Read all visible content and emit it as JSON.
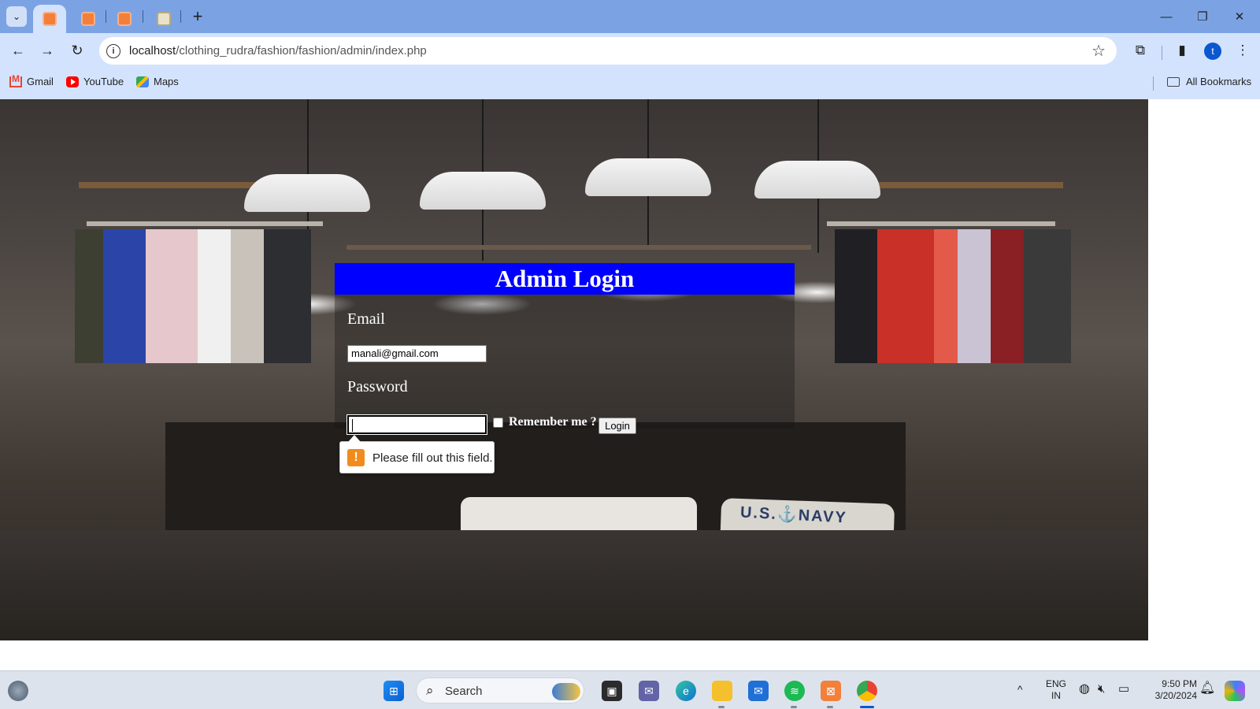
{
  "browser": {
    "address": {
      "host": "localhost",
      "path": "/clothing_rudra/fashion/fashion/admin/index.php"
    },
    "new_tab_symbol": "+",
    "profile_initial": "t",
    "bookmarks": [
      {
        "label": "Gmail",
        "icon": "gmail-icon"
      },
      {
        "label": "YouTube",
        "icon": "youtube-icon"
      },
      {
        "label": "Maps",
        "icon": "maps-icon"
      }
    ],
    "all_bookmarks_label": "All Bookmarks"
  },
  "login": {
    "heading": "Admin Login",
    "email_label": "Email",
    "email_value": "manali@gmail.com",
    "password_label": "Password",
    "password_value": "",
    "remember_label": "Remember me ?",
    "remember_checked": false,
    "submit_label": "Login",
    "heading_color": "#0000ff"
  },
  "validation": {
    "message": "Please fill out this field.",
    "icon_symbol": "!",
    "icon_color": "#f18b1c"
  },
  "background_scene": {
    "navy_text": "U.S.⚓NAVY"
  },
  "taskbar": {
    "search_label": "Search",
    "language": {
      "line1": "ENG",
      "line2": "IN"
    },
    "clock": {
      "time": "9:50 PM",
      "date": "3/20/2024"
    }
  }
}
